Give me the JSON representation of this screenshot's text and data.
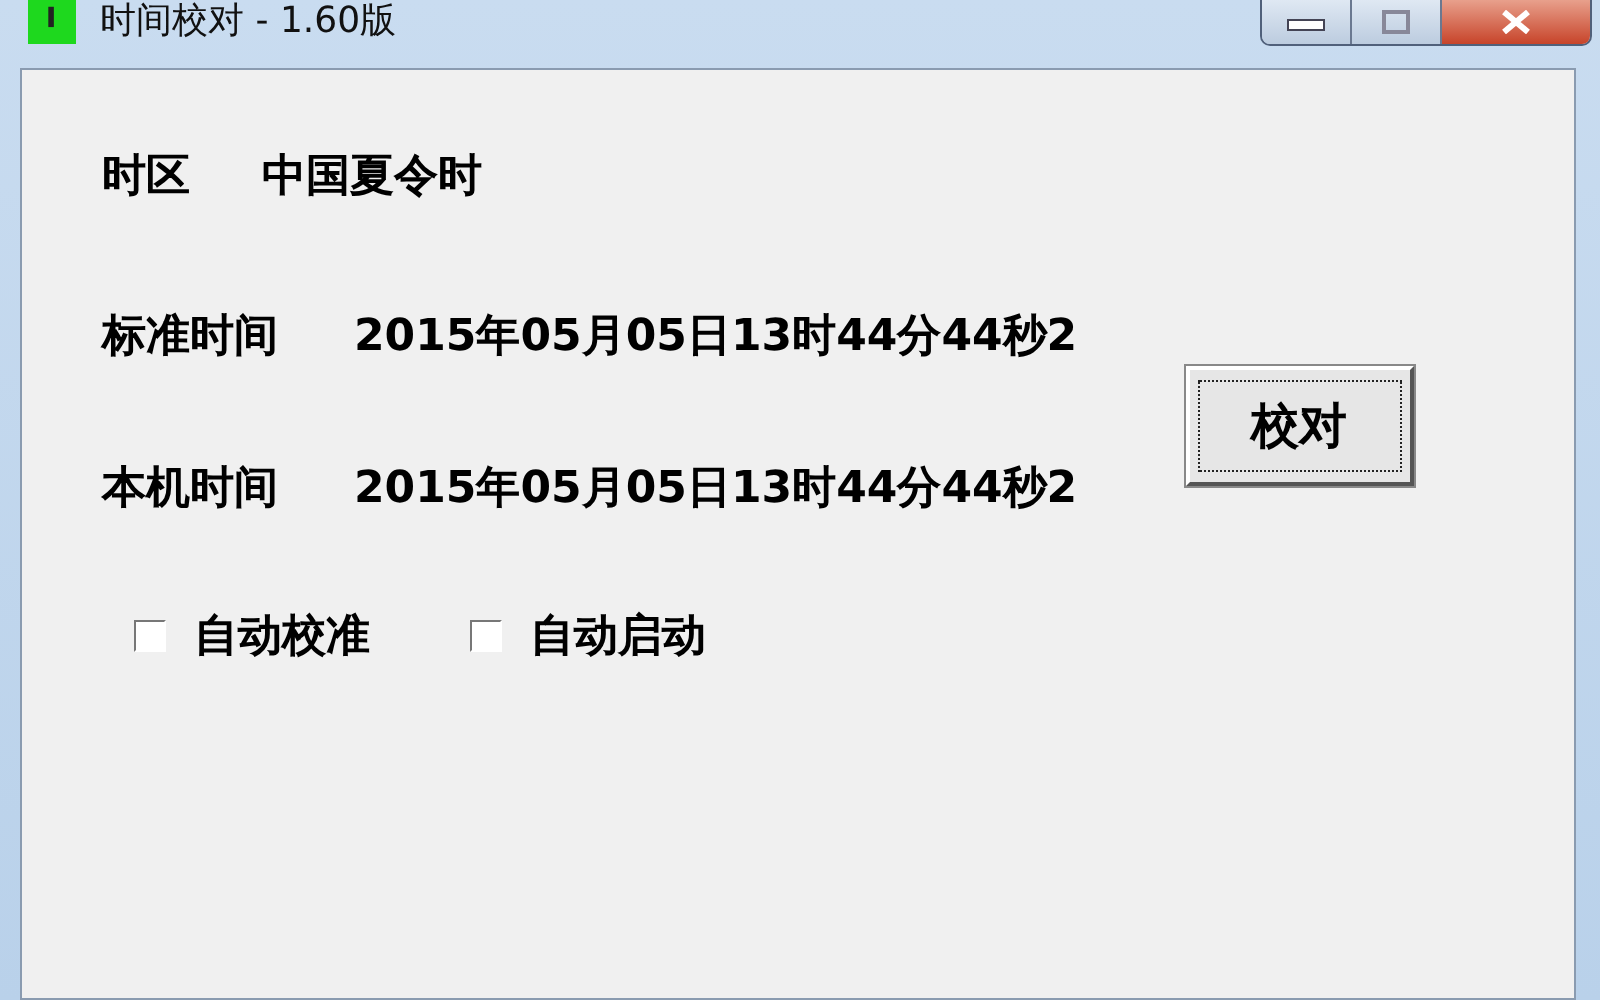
{
  "window": {
    "title": "时间校对 - 1.60版"
  },
  "timezone": {
    "label": "时区",
    "value": "中国夏令时"
  },
  "times": [
    {
      "label": "标准时间",
      "value": "2015年05月05日13时44分44秒2"
    },
    {
      "label": "本机时间",
      "value": "2015年05月05日13时44分44秒2"
    }
  ],
  "calibrate_button": "校对",
  "options": [
    {
      "label": "自动校准",
      "checked": false
    },
    {
      "label": "自动启动",
      "checked": false
    }
  ]
}
